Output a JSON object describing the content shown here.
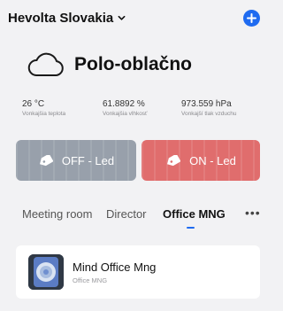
{
  "header": {
    "home_name": "Hevolta Slovakia",
    "add_icon": "plus-circle-icon"
  },
  "weather": {
    "icon": "cloud-icon",
    "condition": "Polo-oblačno",
    "stats": [
      {
        "value": "26 °C",
        "label": "Vonkajšia teplota"
      },
      {
        "value": "61.8892 %",
        "label": "Vonkajšia vlhkosť"
      },
      {
        "value": "973.559 hPa",
        "label": "Vonkajší tlak vzduchu"
      }
    ]
  },
  "scenes": [
    {
      "label": "OFF - Led",
      "icon": "tag-icon",
      "color": "#98a0ab"
    },
    {
      "label": "ON - Led",
      "icon": "tag-icon",
      "color": "#e06d6d"
    }
  ],
  "rooms": {
    "tabs": [
      "Meeting room",
      "Director",
      "Office MNG"
    ],
    "active": "Office MNG",
    "more_icon": "more-horizontal-icon"
  },
  "devices": [
    {
      "name": "Mind Office Mng",
      "room": "Office MNG",
      "icon": "device-thumbnail"
    }
  ],
  "colors": {
    "accent": "#1f6bf0",
    "background": "#f2f2f4"
  }
}
